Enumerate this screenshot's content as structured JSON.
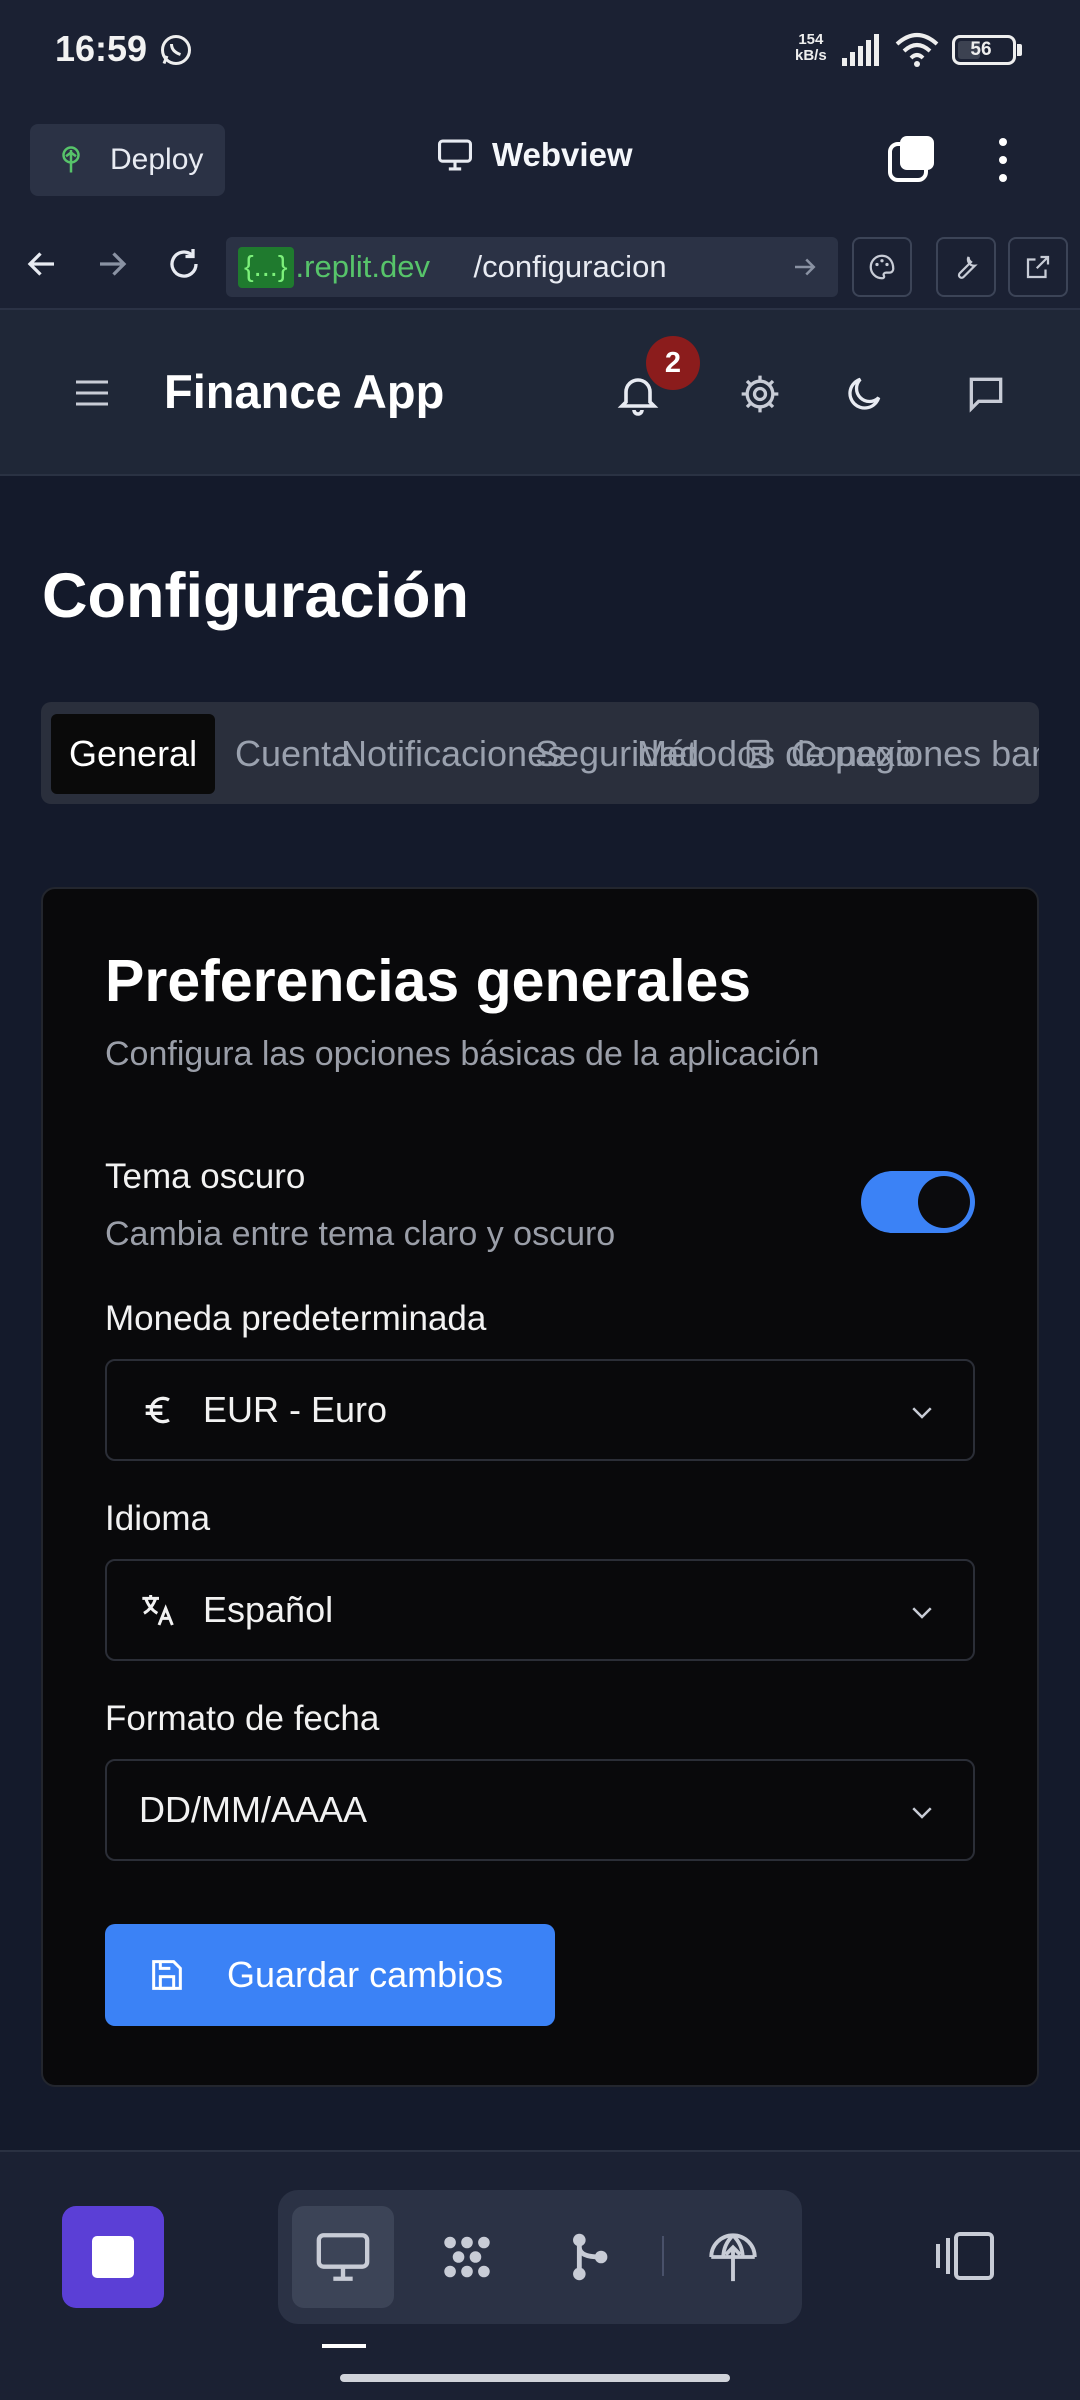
{
  "status_bar": {
    "time": "16:59",
    "net_speed_value": "154",
    "net_speed_unit": "kB/s",
    "battery": "56",
    "battery_fraction": 0.56
  },
  "replit": {
    "deploy_label": "Deploy",
    "webview_title": "Webview",
    "url_badge": "{...}",
    "url_host": ".replit.dev",
    "url_path": "/configuracion"
  },
  "app": {
    "title": "Finance App",
    "notification_count": "2"
  },
  "page": {
    "title": "Configuración",
    "tabs": [
      "General",
      "Cuenta",
      "Notificaciones",
      "Seguridad",
      "Métodos de pago",
      "Conexiones bancarias"
    ]
  },
  "card": {
    "title": "Preferencias generales",
    "description": "Configura las opciones básicas de la aplicación",
    "dark_theme_label": "Tema oscuro",
    "dark_theme_desc": "Cambia entre tema claro y oscuro",
    "dark_theme_on": true,
    "currency_label": "Moneda predeterminada",
    "currency_value": "EUR - Euro",
    "language_label": "Idioma",
    "language_value": "Español",
    "date_format_label": "Formato de fecha",
    "date_format_value": "DD/MM/AAAA",
    "save_label": "Guardar cambios"
  },
  "colors": {
    "accent": "#3b82f6",
    "stop": "#5b3fd6",
    "badge": "#8b1c1c"
  }
}
